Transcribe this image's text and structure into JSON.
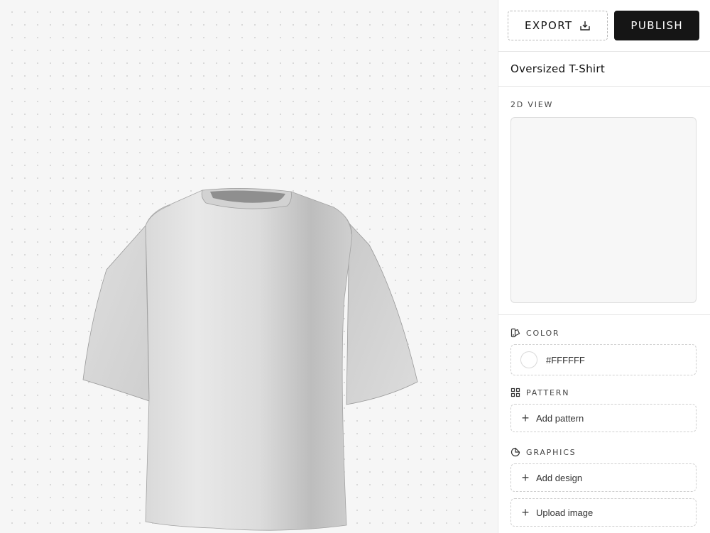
{
  "toolbar": {
    "export_label": "EXPORT",
    "publish_label": "PUBLISH"
  },
  "product": {
    "title": "Oversized T-Shirt"
  },
  "view2d": {
    "label": "2D VIEW"
  },
  "color": {
    "label": "COLOR",
    "value": "#FFFFFF"
  },
  "pattern": {
    "label": "PATTERN",
    "add_label": "Add pattern"
  },
  "graphics": {
    "label": "GRAPHICS",
    "add_design_label": "Add design",
    "upload_label": "Upload image"
  },
  "icons": {
    "export": "download-tray-icon",
    "color": "palette-icon",
    "pattern": "grid-icon",
    "graphics": "sticker-icon",
    "add": "plus-icon"
  },
  "colors": {
    "canvas_bg": "#f6f6f6",
    "publish_bg": "#151515",
    "shirt": "#e6e6e6"
  }
}
